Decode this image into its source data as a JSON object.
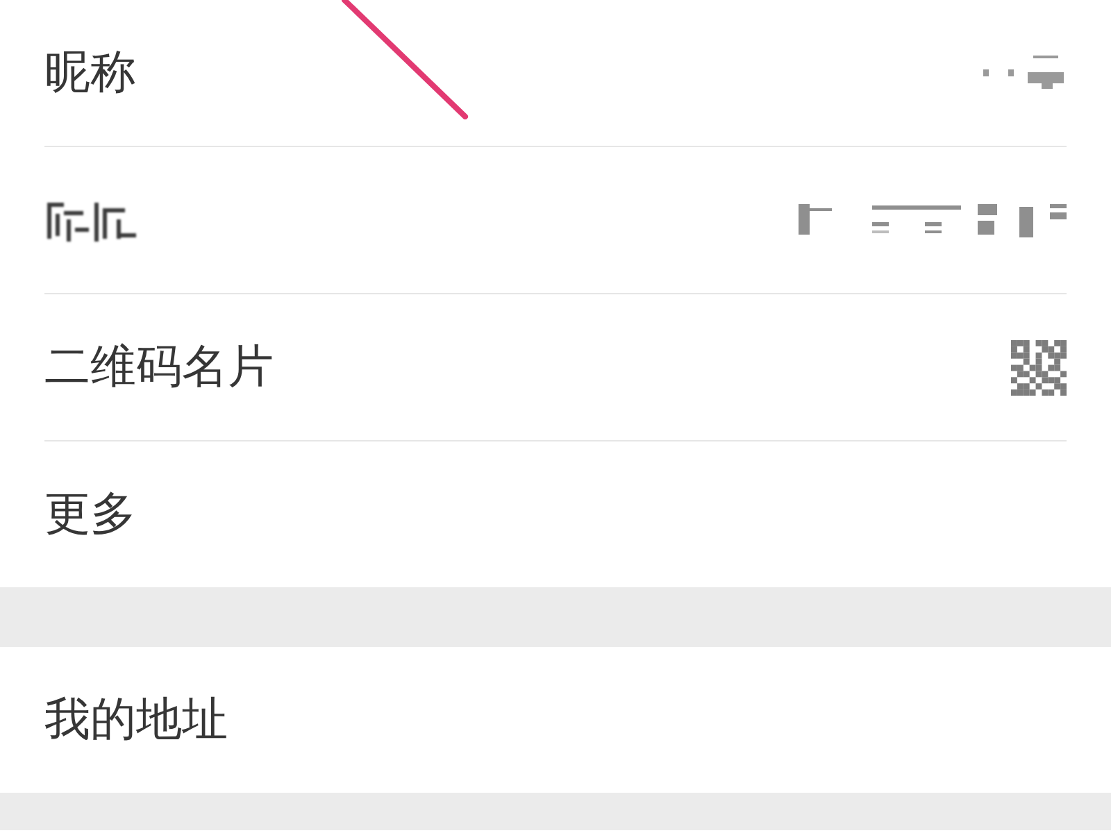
{
  "annotation": {
    "kind": "pointer-line"
  },
  "groups": [
    {
      "rows": [
        {
          "label": "昵称",
          "kind": "blurred-value"
        },
        {
          "kind": "blurred-row"
        },
        {
          "label": "二维码名片",
          "kind": "qr-code"
        },
        {
          "label": "更多",
          "kind": "plain"
        }
      ]
    },
    {
      "rows": [
        {
          "label": "我的地址",
          "kind": "plain"
        }
      ]
    }
  ]
}
